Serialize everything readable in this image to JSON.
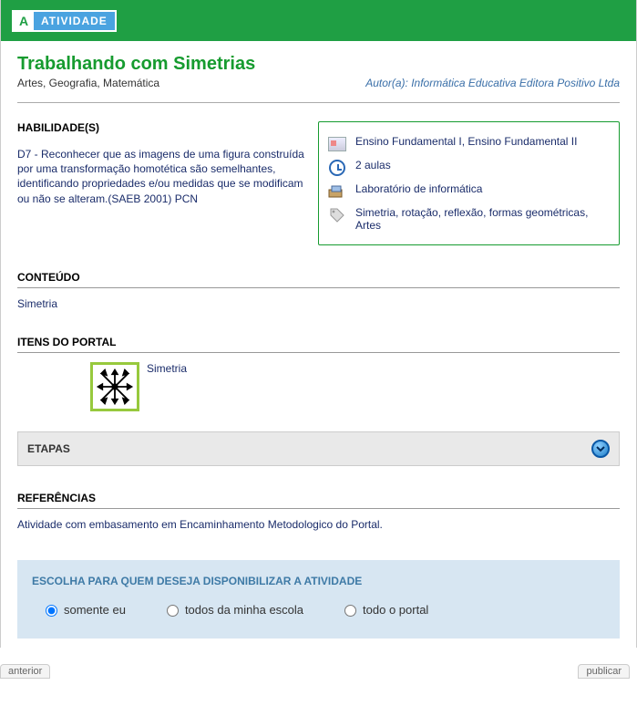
{
  "header": {
    "badge_letter": "A",
    "badge_label": "ATIVIDADE"
  },
  "title": "Trabalhando com Simetrias",
  "subjects": "Artes, Geografia, Matemática",
  "author": "Autor(a): Informática Educativa Editora Positivo Ltda",
  "abilities": {
    "heading": "HABILIDADE(S)",
    "text": "D7 - Reconhecer que as imagens de uma figura construída por uma transformação homotética são semelhantes, identificando propriedades e/ou medidas que se modificam ou não se alteram.(SAEB 2001) PCN"
  },
  "info": {
    "level": "Ensino Fundamental I, Ensino Fundamental II",
    "duration": "2 aulas",
    "location": "Laboratório de informática",
    "tags": "Simetria, rotação, reflexão, formas geométricas, Artes"
  },
  "conteudo": {
    "heading": "CONTEÚDO",
    "text": "Simetria"
  },
  "portal": {
    "heading": "ITENS DO PORTAL",
    "items": [
      {
        "label": "Simetria"
      }
    ]
  },
  "etapas": {
    "heading": "ETAPAS"
  },
  "refs": {
    "heading": "REFERÊNCIAS",
    "text": "Atividade com embasamento em Encaminhamento Metodologico do Portal."
  },
  "share": {
    "heading": "ESCOLHA PARA QUEM DESEJA DISPONIBILIZAR A ATIVIDADE",
    "options": {
      "me": "somente eu",
      "school": "todos da minha escola",
      "portal": "todo o portal"
    },
    "selected": "me"
  },
  "footer": {
    "prev": "anterior",
    "next": "publicar"
  }
}
